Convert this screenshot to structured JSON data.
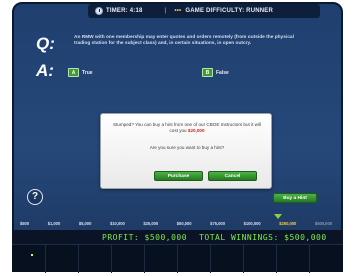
{
  "header": {
    "timer": "TIMER: 4:18",
    "separator": "|",
    "difficulty_dots": "•••",
    "difficulty": "GAME DIFFICULTY: RUNNER"
  },
  "question": {
    "q_label": "Q:",
    "text": "An RMW with one membership may enter quotes and orders remotely (from outside the physical trading station for the subject class) and, in certain situations, in open outcry.",
    "a_label": "A:"
  },
  "answers": [
    {
      "key": "A",
      "label": "True"
    },
    {
      "key": "B",
      "label": "False"
    }
  ],
  "dialog": {
    "message_prefix": "Stumped? You can buy a hint from one of our CBOE Instructors but it will cost you",
    "cost": "$20,000",
    "message_suffix": "",
    "confirm": "Are you sure you want to buy a hint?",
    "purchase_label": "Purchase",
    "cancel_label": "Cancel"
  },
  "help_icon_glyph": "?",
  "hint_button_label": "Buy a Hint",
  "prize_ladder": [
    "$500",
    "$1,000",
    "$5,000",
    "$10,000",
    "$25,000",
    "$50,000",
    "$75,000",
    "$100,000",
    "$250,000",
    "$500,000"
  ],
  "prize_ladder_current_index": 8,
  "score": {
    "profit": "PROFIT: $500,000",
    "total_winnings": "TOTAL WINNINGS: $500,000"
  },
  "colors": {
    "panel": "#25487a",
    "answer_key": "#3e9a36",
    "button_green": "#2f8b2a",
    "score_text": "#7fe84a",
    "cost_red": "#c62828",
    "current_prize": "#f4d24b"
  }
}
